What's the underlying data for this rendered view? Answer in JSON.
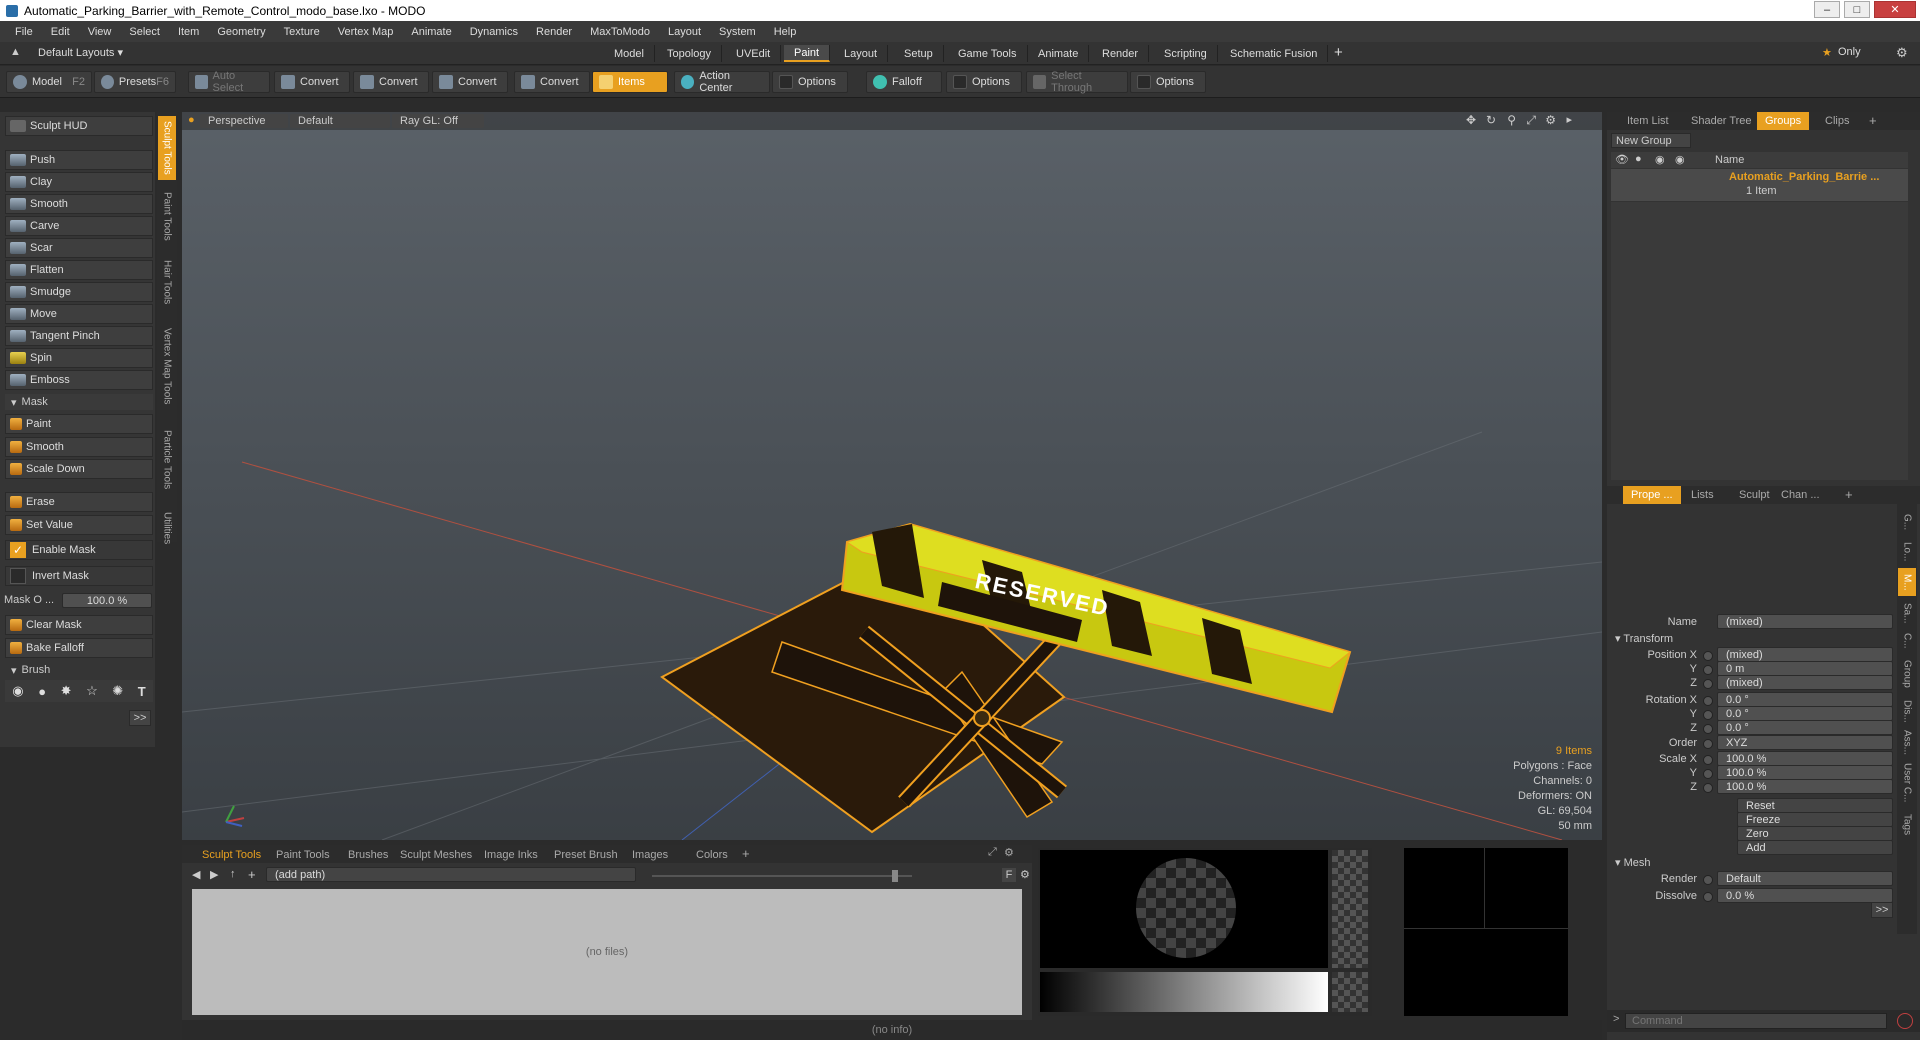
{
  "window": {
    "title": "Automatic_Parking_Barrier_with_Remote_Control_modo_base.lxo - MODO"
  },
  "menu": [
    "File",
    "Edit",
    "View",
    "Select",
    "Item",
    "Geometry",
    "Texture",
    "Vertex Map",
    "Animate",
    "Dynamics",
    "Render",
    "MaxToModo",
    "Layout",
    "System",
    "Help"
  ],
  "layoutbar": {
    "default_layouts": "Default Layouts ▾",
    "tabs": [
      "Model",
      "Topology",
      "UVEdit",
      "Paint",
      "Layout",
      "Setup",
      "Game Tools",
      "Animate",
      "Render",
      "Scripting",
      "Schematic Fusion"
    ],
    "active": "Paint",
    "only": "Only"
  },
  "toolbar": {
    "model": "Model",
    "model_key": "F2",
    "presets": "Presets",
    "presets_key": "F6",
    "auto_select": "Auto Select",
    "convert": "Convert",
    "items": "Items",
    "action_center": "Action Center",
    "options": "Options",
    "falloff": "Falloff",
    "select_through": "Select Through"
  },
  "sculpt": {
    "hud": "Sculpt HUD",
    "tools": [
      "Push",
      "Clay",
      "Smooth",
      "Carve",
      "Scar",
      "Flatten",
      "Smudge",
      "Move",
      "Tangent Pinch",
      "Spin",
      "Emboss"
    ],
    "mask_header": "Mask",
    "mask_tools": [
      "Paint",
      "Smooth",
      "Scale Down"
    ],
    "erase": "Erase",
    "set_value": "Set Value",
    "enable_mask": "Enable Mask",
    "invert_mask": "Invert Mask",
    "mask_opacity_label": "Mask O ...",
    "mask_opacity": "100.0 %",
    "clear_mask": "Clear Mask",
    "bake_falloff": "Bake Falloff",
    "brush_header": "Brush",
    "more": ">>"
  },
  "vtabs": [
    "Sculpt Tools",
    "Paint Tools",
    "Hair Tools",
    "Vertex Map Tools",
    "Particle Tools",
    "Utilities"
  ],
  "viewport": {
    "perspective": "Perspective",
    "default": "Default",
    "raygl": "Ray GL: Off",
    "label": "RESERVED",
    "info_items": "9 Items",
    "info": [
      "Polygons : Face",
      "Channels: 0",
      "Deformers: ON",
      "GL: 69,504",
      "50 mm"
    ]
  },
  "groups": {
    "tabs": [
      "Item List",
      "Shader Tree",
      "Groups",
      "Clips"
    ],
    "active": "Groups",
    "new_group": "New Group",
    "name_col": "Name",
    "group_name": "Automatic_Parking_Barrie ...",
    "group_count": "1 Item"
  },
  "properties": {
    "tabs": [
      "Prope ...",
      "Lists",
      "Sculpt",
      "Chan ..."
    ],
    "name_label": "Name",
    "name_value": "(mixed)",
    "transform": "Transform",
    "rows": [
      {
        "label": "Position X",
        "value": "(mixed)"
      },
      {
        "label": "Y",
        "value": "0 m"
      },
      {
        "label": "Z",
        "value": "(mixed)"
      },
      {
        "label": "Rotation X",
        "value": "0.0 °"
      },
      {
        "label": "Y",
        "value": "0.0 °"
      },
      {
        "label": "Z",
        "value": "0.0 °"
      },
      {
        "label": "Order",
        "value": "XYZ"
      },
      {
        "label": "Scale X",
        "value": "100.0 %"
      },
      {
        "label": "Y",
        "value": "100.0 %"
      },
      {
        "label": "Z",
        "value": "100.0 %"
      }
    ],
    "actions": [
      "Reset",
      "Freeze",
      "Zero",
      "Add"
    ],
    "mesh": "Mesh",
    "render_label": "Render",
    "render_value": "Default",
    "dissolve_label": "Dissolve",
    "dissolve_value": "0.0 %",
    "more": ">>",
    "side_tabs": [
      "G...",
      "Lo...",
      "M...",
      "Sa...",
      "C...",
      "Group",
      "Dis...",
      "Ass...",
      "User C...",
      "Tags"
    ],
    "command_placeholder": "Command"
  },
  "bottom": {
    "tabs": [
      "Sculpt Tools",
      "Paint Tools",
      "Brushes",
      "Sculpt Meshes",
      "Image Inks",
      "Preset Brush",
      "Images",
      "Colors"
    ],
    "active": "Sculpt Tools",
    "path": "(add path)",
    "no_files": "(no files)",
    "f_btn": "F"
  },
  "status": {
    "text": "(no info)"
  }
}
